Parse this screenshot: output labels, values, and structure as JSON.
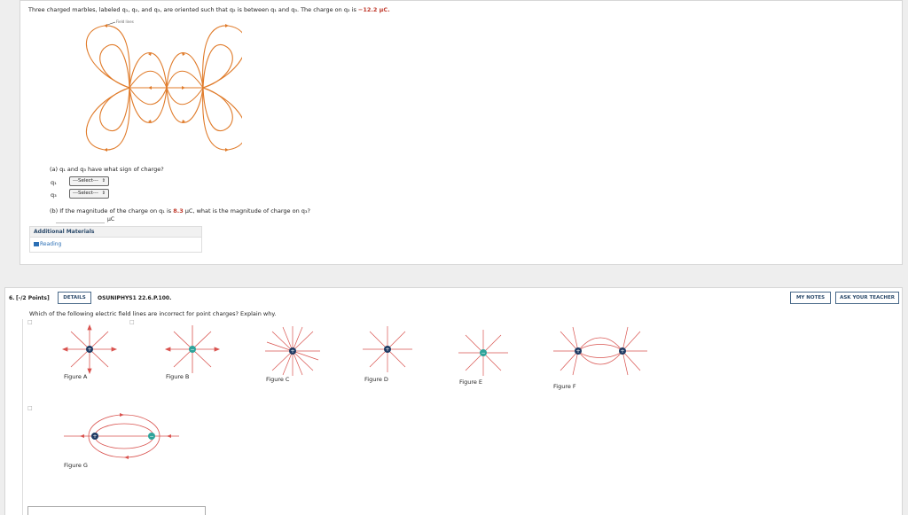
{
  "q5": {
    "intro_part1": "Three charged marbles, labeled ",
    "intro_charges": "q₁, q₂, and q₃, are oriented such that q₂ is between q₁ and q₃. The charge on q₂ is ",
    "q2_value": "−12.2 μC.",
    "diagram_caption": "Field lines",
    "part_a_prompt": "(a) q₁ and q₃ have what sign of charge?",
    "q1_label": "q₁",
    "q3_label": "q₃",
    "select_value": "---Select---",
    "part_b_prompt_pre": "(b) If the magnitude of the charge on q₁ is ",
    "part_b_value": "8.3",
    "part_b_prompt_post": " μC, what is the magnitude of charge on q₃?",
    "unit": "μC",
    "additional_materials": "Additional Materials",
    "reading_link": "Reading"
  },
  "q6": {
    "number": "6.",
    "points": "[-/2 Points]",
    "details_btn": "DETAILS",
    "source": "OSUNIPHYS1 22.6.P.100.",
    "my_notes_btn": "MY NOTES",
    "ask_teacher_btn": "ASK YOUR TEACHER",
    "prompt": "Which of the following electric field lines are incorrect for point charges? Explain why.",
    "figures": [
      "Figure A",
      "Figure B",
      "Figure C",
      "Figure D",
      "Figure E",
      "Figure F",
      "Figure G"
    ]
  },
  "colors": {
    "field_orange": "#e07b2a",
    "arrow_red": "#d9534f",
    "charge_navy": "#1f3b63",
    "charge_teal": "#2ea39a",
    "accent_red": "#c0392b"
  }
}
